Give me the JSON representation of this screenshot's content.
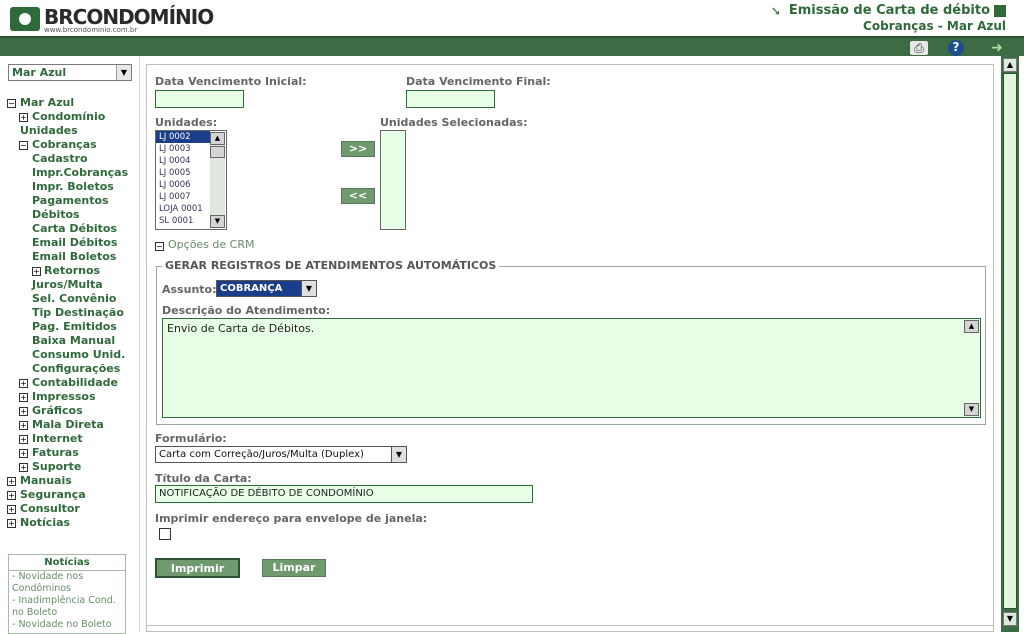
{
  "header": {
    "logo_text": "BRCONDOMÍNIO",
    "logo_url_text": "www.brcondominio.com.br",
    "title": "Emissão de Carta de débito",
    "subtitle": "Cobranças - Mar Azul"
  },
  "toolbar": {
    "print_icon": "printer-icon",
    "help_icon": "help-icon",
    "exit_icon": "exit-icon"
  },
  "sidebar": {
    "condo_select": "Mar Azul",
    "tree": [
      {
        "label": "Mar Azul",
        "level": 0,
        "toggle": "−"
      },
      {
        "label": "Condomínio",
        "level": 1,
        "toggle": "+"
      },
      {
        "label": "Unidades",
        "level": 0,
        "toggle": ""
      },
      {
        "label": "Cobranças",
        "level": 1,
        "toggle": "−"
      },
      {
        "label": "Cadastro",
        "level": 2,
        "toggle": ""
      },
      {
        "label": "Impr.Cobranças",
        "level": 2,
        "toggle": ""
      },
      {
        "label": "Impr. Boletos",
        "level": 2,
        "toggle": ""
      },
      {
        "label": "Pagamentos",
        "level": 2,
        "toggle": ""
      },
      {
        "label": "Débitos",
        "level": 2,
        "toggle": ""
      },
      {
        "label": "Carta Débitos",
        "level": 2,
        "toggle": ""
      },
      {
        "label": "Email Débitos",
        "level": 2,
        "toggle": ""
      },
      {
        "label": "Email Boletos",
        "level": 2,
        "toggle": ""
      },
      {
        "label": "Retornos",
        "level": 2,
        "toggle": "+"
      },
      {
        "label": "Juros/Multa",
        "level": 2,
        "toggle": ""
      },
      {
        "label": "Sel. Convênio",
        "level": 2,
        "toggle": ""
      },
      {
        "label": "Tip Destinação",
        "level": 2,
        "toggle": ""
      },
      {
        "label": "Pag. Emitidos",
        "level": 2,
        "toggle": ""
      },
      {
        "label": "Baixa Manual",
        "level": 2,
        "toggle": ""
      },
      {
        "label": "Consumo Unid.",
        "level": 2,
        "toggle": ""
      },
      {
        "label": "Configurações",
        "level": 2,
        "toggle": ""
      },
      {
        "label": "Contabilidade",
        "level": 1,
        "toggle": "+"
      },
      {
        "label": "Impressos",
        "level": 1,
        "toggle": "+"
      },
      {
        "label": "Gráficos",
        "level": 1,
        "toggle": "+"
      },
      {
        "label": "Mala Direta",
        "level": 1,
        "toggle": "+"
      },
      {
        "label": "Internet",
        "level": 1,
        "toggle": "+"
      },
      {
        "label": "Faturas",
        "level": 1,
        "toggle": "+"
      },
      {
        "label": "Suporte",
        "level": 1,
        "toggle": "+"
      },
      {
        "label": "Manuais",
        "level": 0,
        "toggle": "+"
      },
      {
        "label": "Segurança",
        "level": 0,
        "toggle": "+"
      },
      {
        "label": "Consultor",
        "level": 0,
        "toggle": "+"
      },
      {
        "label": "Notícias",
        "level": 0,
        "toggle": "+"
      }
    ],
    "news": {
      "title": "Notícias",
      "items": [
        "- Novidade nos Condôminos",
        "- Inadimplência Cond. no Boleto",
        "- Novidade no Boleto"
      ]
    }
  },
  "form": {
    "date_start_label": "Data Vencimento Inicial:",
    "date_start_value": "",
    "date_end_label": "Data Vencimento Final:",
    "date_end_value": "",
    "units_label": "Unidades:",
    "units": [
      "LJ 0002",
      "LJ 0003",
      "LJ 0004",
      "LJ 0005",
      "LJ 0006",
      "LJ 0007",
      "LOJA 0001",
      "SL 0001"
    ],
    "units_selected_index": 0,
    "selected_units_label": "Unidades Selecionadas:",
    "add_button": ">>",
    "remove_button": "<<",
    "crm_toggle_label": "Opções de CRM",
    "fieldset_legend": "GERAR REGISTROS DE ATENDIMENTOS AUTOMÁTICOS",
    "subject_label": "Assunto:",
    "subject_value": "COBRANÇA",
    "description_label": "Descrição do Atendimento:",
    "description_value": "Envio de Carta de Débitos.",
    "form_label": "Formulário:",
    "form_value": "Carta com Correção/Juros/Multa (Duplex)",
    "letter_title_label": "Título da Carta:",
    "letter_title_value": "NOTIFICAÇÃO DE DÉBITO DE CONDOMÍNIO",
    "window_envelope_label": "Imprimir endereço para envelope de janela:",
    "window_envelope_checked": false,
    "print_button": "Imprimir",
    "clear_button": "Limpar"
  },
  "colors": {
    "brand_green": "#2f6a3a",
    "band_green": "#3d6b43",
    "input_bg": "#e7ffe7",
    "button_green": "#6e9a6e"
  }
}
